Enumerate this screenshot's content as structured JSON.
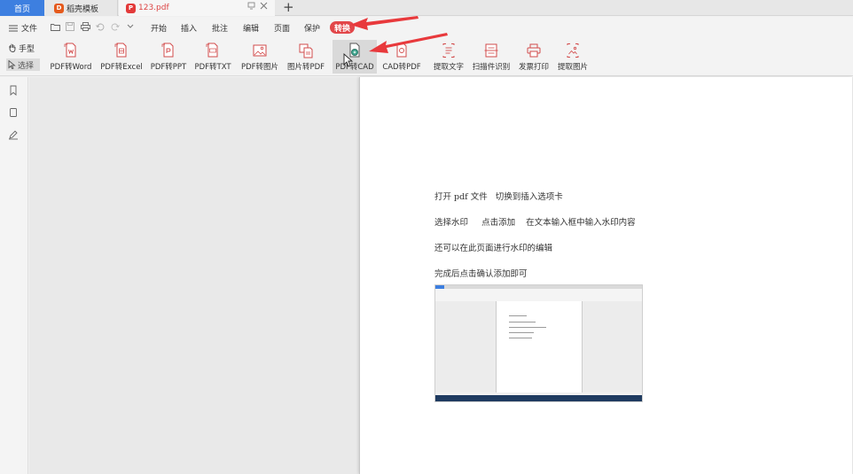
{
  "tabs": {
    "home": "首页",
    "templates": "稻壳模板",
    "doc": "123.pdf",
    "add": "+"
  },
  "menu": {
    "file": "文件",
    "items": [
      "开始",
      "插入",
      "批注",
      "编辑",
      "页面",
      "保护"
    ],
    "active": "转换"
  },
  "ribbon": {
    "hand": "手型",
    "select": "选择",
    "tools": [
      {
        "label": "PDF转Word",
        "icon": "pdf-to-word-icon"
      },
      {
        "label": "PDF转Excel",
        "icon": "pdf-to-excel-icon"
      },
      {
        "label": "PDF转PPT",
        "icon": "pdf-to-ppt-icon"
      },
      {
        "label": "PDF转TXT",
        "icon": "pdf-to-txt-icon"
      },
      {
        "label": "PDF转图片",
        "icon": "pdf-to-image-icon"
      },
      {
        "label": "图片转PDF",
        "icon": "image-to-pdf-icon"
      },
      {
        "label": "PDF转CAD",
        "icon": "pdf-to-cad-icon"
      },
      {
        "label": "CAD转PDF",
        "icon": "cad-to-pdf-icon"
      },
      {
        "label": "提取文字",
        "icon": "extract-text-icon"
      },
      {
        "label": "扫描件识别",
        "icon": "scan-ocr-icon"
      },
      {
        "label": "发票打印",
        "icon": "invoice-print-icon"
      },
      {
        "label": "提取图片",
        "icon": "extract-image-icon"
      }
    ]
  },
  "document": {
    "lines": [
      "打开 pdf 文件   切换到插入选项卡",
      "选择水印     点击添加    在文本输入框中输入水印内容",
      "还可以在此页面进行水印的编辑",
      "完成后点击确认添加即可"
    ]
  },
  "colors": {
    "accent_blue": "#3d7fe0",
    "active_tab_red": "#e2474a",
    "arrow_red": "#e8393c"
  }
}
